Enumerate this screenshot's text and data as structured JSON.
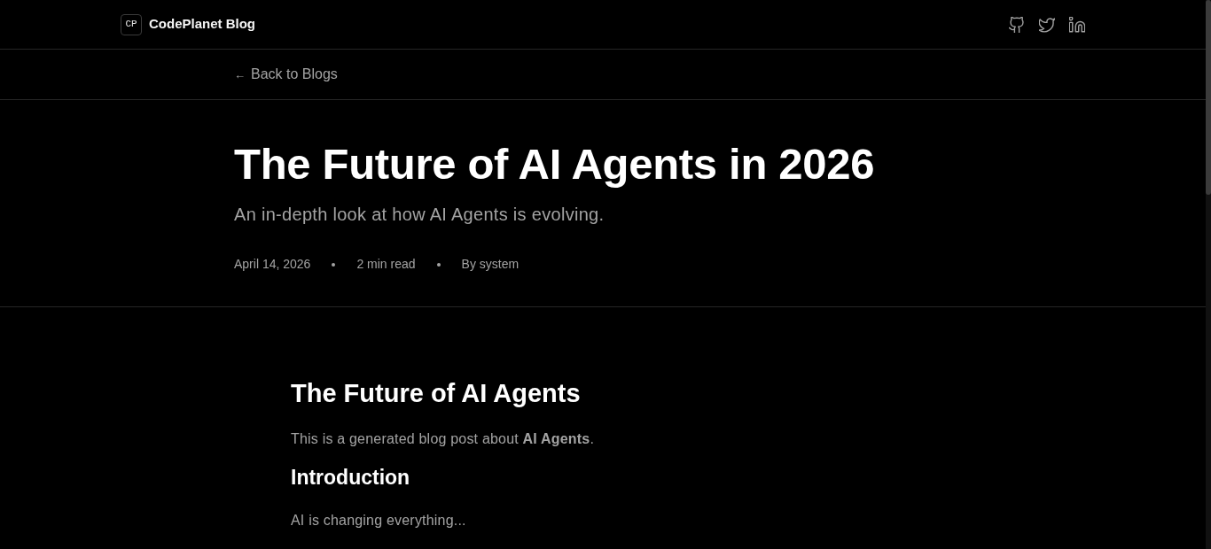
{
  "header": {
    "logo": "CP",
    "brand": "CodePlanet Blog",
    "social_links": [
      {
        "kind": "github"
      },
      {
        "kind": "twitter"
      },
      {
        "kind": "linkedin"
      }
    ]
  },
  "back_link": {
    "arrow": "←",
    "label": "Back to Blogs"
  },
  "post": {
    "title": "The Future of AI Agents in 2026",
    "subtitle": "An in-depth look at how AI Agents is evolving.",
    "meta": [
      "April 14, 2026",
      "2 min read",
      "By system"
    ]
  },
  "article": {
    "blocks": [
      {
        "kind": "heading",
        "text": "The Future of AI Agents"
      },
      {
        "kind": "paragraph",
        "text": "This is a generated blog post about **AI Agents**."
      },
      {
        "kind": "subheading",
        "text": "Introduction"
      },
      {
        "kind": "paragraph",
        "text": "AI is changing everything..."
      }
    ]
  }
}
